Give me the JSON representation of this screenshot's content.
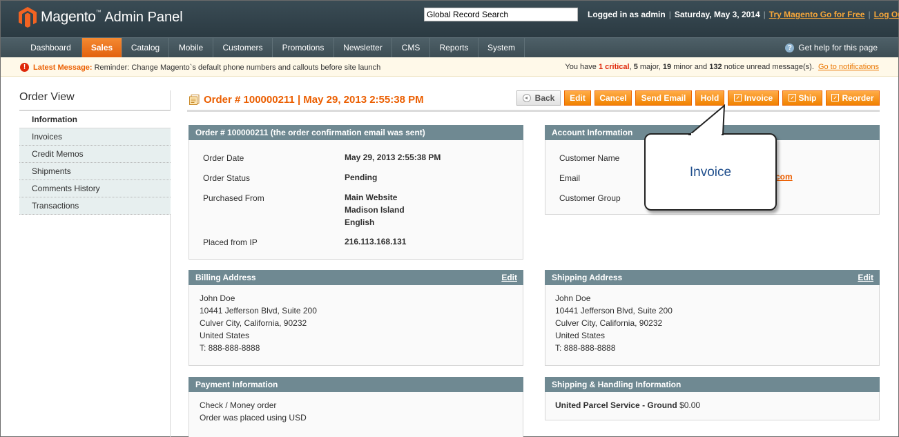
{
  "header": {
    "logo_name": "Magento",
    "logo_tm": "™",
    "logo_sub": "Admin Panel",
    "search_value": "Global Record Search",
    "logged_in": "Logged in as admin",
    "date": "Saturday, May 3, 2014",
    "try_link": "Try Magento Go for Free",
    "logout_link": "Log Out"
  },
  "nav": {
    "items": [
      "Dashboard",
      "Sales",
      "Catalog",
      "Mobile",
      "Customers",
      "Promotions",
      "Newsletter",
      "CMS",
      "Reports",
      "System"
    ],
    "active": "Sales",
    "help": "Get help for this page"
  },
  "message": {
    "label": "Latest Message:",
    "text": "Reminder: Change Magento`s default phone numbers and callouts before site launch",
    "prefix": "You have",
    "critical": "1 critical",
    "major": "5",
    "major_label": "major,",
    "minor": "19",
    "minor_label": "minor and",
    "notice": "132",
    "notice_label": "notice unread message(s).",
    "link": "Go to notifications"
  },
  "sidebar": {
    "title": "Order View",
    "tabs": [
      "Information",
      "Invoices",
      "Credit Memos",
      "Shipments",
      "Comments History",
      "Transactions"
    ],
    "active": "Information"
  },
  "order": {
    "title": "Order # 100000211 | May 29, 2013 2:55:38 PM",
    "buttons": {
      "back": "Back",
      "edit": "Edit",
      "cancel": "Cancel",
      "send_email": "Send Email",
      "hold": "Hold",
      "invoice": "Invoice",
      "ship": "Ship",
      "reorder": "Reorder"
    }
  },
  "order_box": {
    "header": "Order # 100000211 (the order confirmation email was sent)",
    "rows": [
      {
        "label": "Order Date",
        "value": "May 29, 2013 2:55:38 PM"
      },
      {
        "label": "Order Status",
        "value": "Pending"
      },
      {
        "label": "Purchased From",
        "value": [
          "Main Website",
          "Madison Island",
          "English"
        ]
      },
      {
        "label": "Placed from IP",
        "value": "216.113.168.131"
      }
    ]
  },
  "account_box": {
    "header": "Account Information",
    "labels": [
      "Customer Name",
      "Email",
      "Customer Group"
    ],
    "email_fragment": "com"
  },
  "billing": {
    "header": "Billing Address",
    "edit": "Edit",
    "lines": [
      "John Doe",
      "10441 Jefferson Blvd, Suite 200",
      "Culver City, California, 90232",
      "United States",
      "T: 888-888-8888"
    ]
  },
  "shipping": {
    "header": "Shipping Address",
    "edit": "Edit",
    "lines": [
      "John Doe",
      "10441 Jefferson Blvd, Suite 200",
      "Culver City, California, 90232",
      "United States",
      "T: 888-888-8888"
    ]
  },
  "payment": {
    "header": "Payment Information",
    "lines": [
      "Check / Money order",
      "Order was placed using USD"
    ]
  },
  "shipping_handling": {
    "header": "Shipping & Handling Information",
    "method": "United Parcel Service - Ground",
    "price": "$0.00"
  },
  "callout": {
    "text": "Invoice"
  },
  "colors": {
    "accent": "#eb5e00",
    "header_bg": "#2b3a42",
    "box_header": "#6f8992"
  }
}
